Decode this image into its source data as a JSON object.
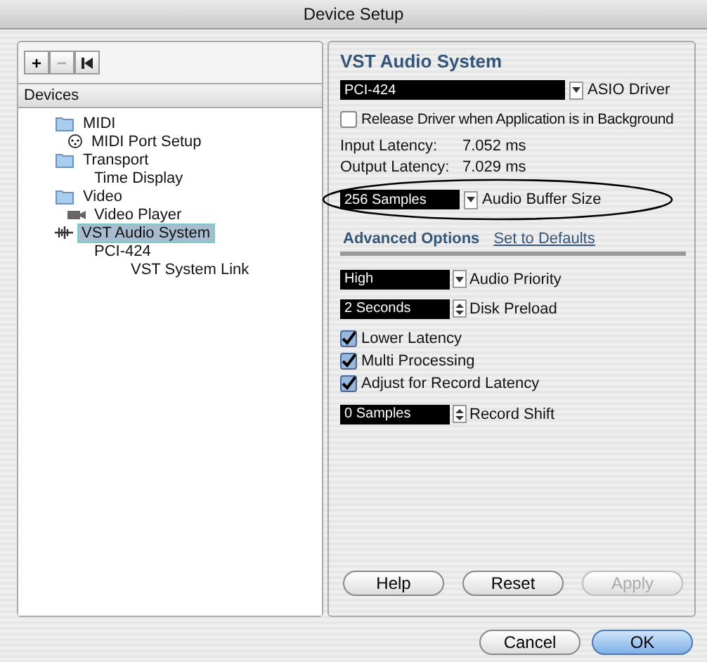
{
  "window": {
    "title": "Device Setup"
  },
  "toolbar": [
    {
      "label": "+",
      "disabled": false
    },
    {
      "label": "−",
      "disabled": true
    },
    {
      "kind": "reset",
      "disabled": false
    }
  ],
  "devices": {
    "header": "Devices",
    "items": [
      {
        "label": "MIDI",
        "kind": "folder",
        "selected": false,
        "children": [
          {
            "label": "MIDI Port Setup",
            "kind": "port",
            "selected": false
          }
        ]
      },
      {
        "label": "Transport",
        "kind": "folder",
        "selected": false,
        "children": [
          {
            "label": "Time Display",
            "selected": false
          }
        ]
      },
      {
        "label": "Video",
        "kind": "folder",
        "selected": false,
        "children": [
          {
            "label": "Video Player",
            "kind": "video",
            "selected": false
          }
        ]
      },
      {
        "label": "VST Audio System",
        "kind": "audio",
        "selected": true,
        "children": [
          {
            "label": "PCI-424",
            "selected": false,
            "children": [
              {
                "label": "VST System Link",
                "selected": false
              }
            ]
          }
        ]
      }
    ]
  },
  "panel": {
    "title": "VST Audio System",
    "driver": {
      "value": "PCI-424",
      "label": "ASIO Driver"
    },
    "release_driver": {
      "label": "Release Driver when Application is in Background",
      "checked": false
    },
    "latencies": [
      {
        "label": "Input Latency:",
        "value": "7.052 ms"
      },
      {
        "label": "Output Latency:",
        "value": "7.029 ms"
      }
    ],
    "buffer": {
      "value": "256 Samples",
      "label": "Audio Buffer Size",
      "circled": true
    },
    "tabs": [
      {
        "label": "Advanced Options",
        "selected": true
      },
      {
        "label": "Set to Defaults",
        "selected": false
      }
    ],
    "options": [
      {
        "kind": "dropdown",
        "value": "High",
        "label": "Audio Priority"
      },
      {
        "kind": "spinner",
        "value": "2 Seconds",
        "label": "Disk Preload"
      },
      {
        "kind": "checkbox",
        "text": "Lower Latency",
        "checked": true
      },
      {
        "kind": "checkbox",
        "text": "Multi Processing",
        "checked": true
      },
      {
        "kind": "checkbox",
        "text": "Adjust for Record Latency",
        "checked": true
      },
      {
        "kind": "spinner",
        "value": "0 Samples",
        "label": "Record Shift"
      }
    ],
    "buttons": [
      {
        "label": "Help",
        "disabled": false
      },
      {
        "label": "Reset",
        "disabled": false
      },
      {
        "label": "Apply",
        "disabled": true
      }
    ]
  },
  "footer_buttons": [
    {
      "label": "Cancel",
      "default": false
    },
    {
      "label": "OK",
      "default": true
    }
  ]
}
